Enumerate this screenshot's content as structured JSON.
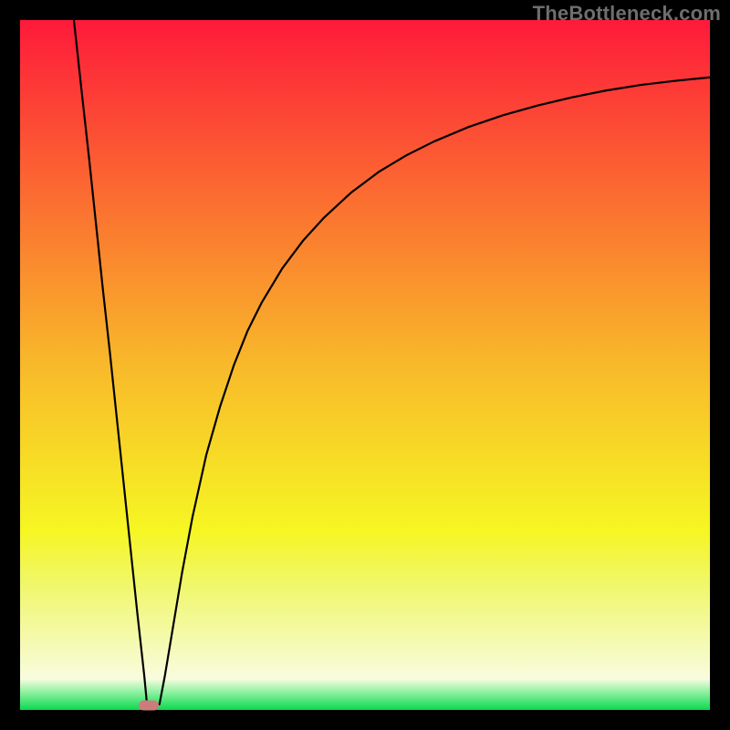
{
  "watermark": {
    "text": "TheBottleneck.com"
  },
  "chart_data": {
    "type": "line",
    "title": "",
    "xlabel": "",
    "ylabel": "",
    "xlim": [
      0,
      100
    ],
    "ylim": [
      0,
      100
    ],
    "grid": false,
    "legend": false,
    "background": {
      "type": "vertical-gradient",
      "stops": [
        {
          "pos": 0.0,
          "color": "#fe1a3a"
        },
        {
          "pos": 0.28,
          "color": "#fb7430"
        },
        {
          "pos": 0.5,
          "color": "#f8b92a"
        },
        {
          "pos": 0.74,
          "color": "#f6f623"
        },
        {
          "pos": 0.82,
          "color": "#f0f76c"
        },
        {
          "pos": 0.955,
          "color": "#f8fcde"
        },
        {
          "pos": 0.975,
          "color": "#89f19e"
        },
        {
          "pos": 1.0,
          "color": "#0cd950"
        }
      ]
    },
    "series": [
      {
        "name": "bottleneck-curve",
        "color": "#000000",
        "x": [
          7.8,
          9,
          10,
          11,
          12,
          13,
          14,
          15,
          16,
          17,
          18,
          18.4,
          19.0,
          20.2,
          21,
          22,
          23.5,
          25,
          27,
          29,
          31,
          33,
          35,
          38,
          41,
          44,
          48,
          52,
          56,
          60,
          65,
          70,
          75,
          80,
          85,
          90,
          95,
          100
        ],
        "y": [
          100,
          89,
          80,
          70.5,
          61,
          52,
          42.5,
          33,
          23.5,
          14,
          5,
          0.8,
          0.8,
          0.8,
          5,
          11,
          20,
          28,
          37,
          44,
          50,
          55,
          59,
          64,
          68,
          71.3,
          75,
          78,
          80.4,
          82.4,
          84.5,
          86.2,
          87.6,
          88.8,
          89.8,
          90.6,
          91.2,
          91.7
        ]
      }
    ],
    "marker": {
      "name": "optimal-point",
      "color": "#cd7c7d",
      "x": 18.7,
      "y": 0.7,
      "shape": "pill"
    }
  }
}
